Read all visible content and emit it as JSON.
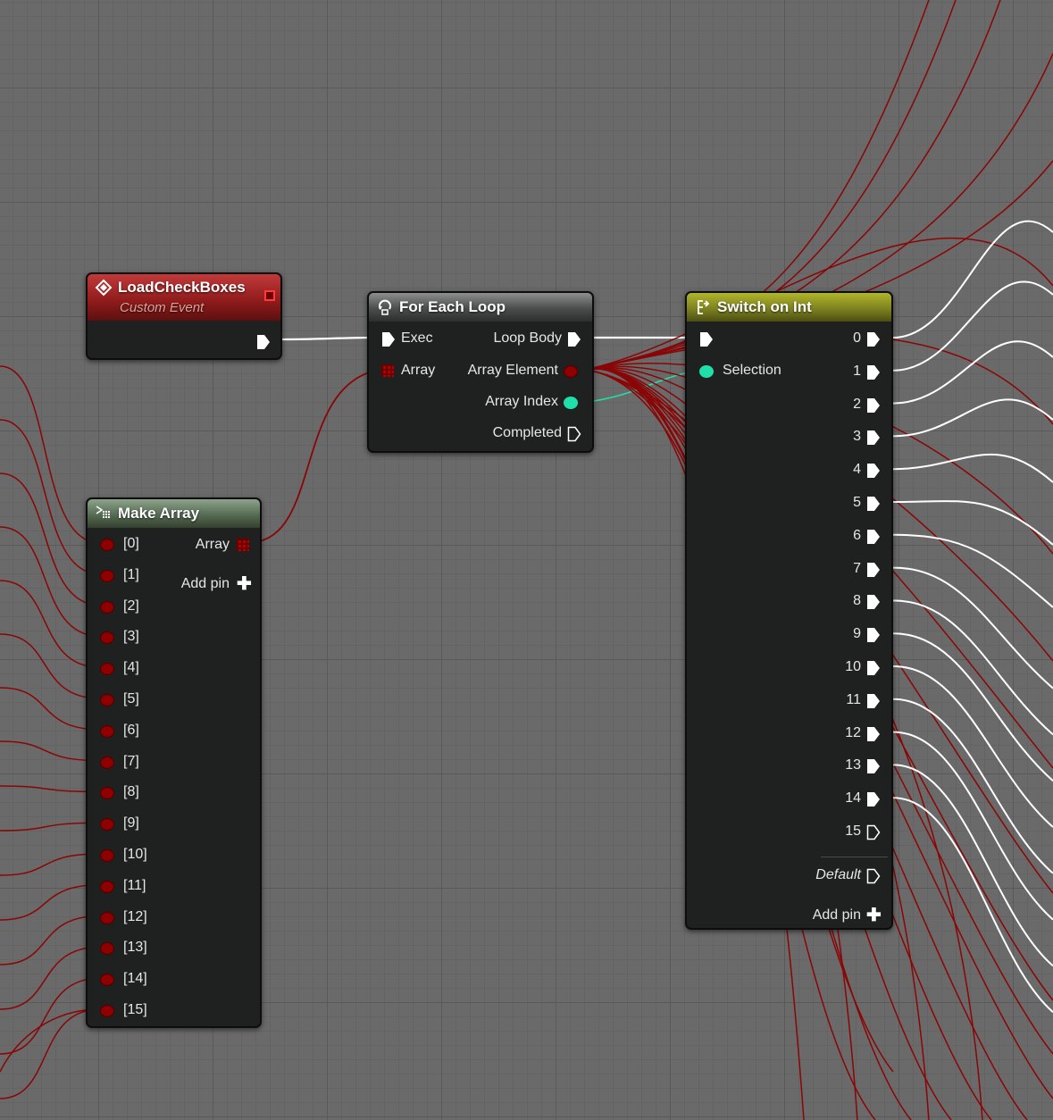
{
  "nodes": {
    "event": {
      "title": "LoadCheckBoxes",
      "subtitle": "Custom Event"
    },
    "foreach": {
      "title": "For Each Loop",
      "exec_label": "Exec",
      "array_label": "Array",
      "loop_body_label": "Loop Body",
      "array_element_label": "Array Element",
      "array_index_label": "Array Index",
      "completed_label": "Completed"
    },
    "make_array": {
      "title": "Make Array",
      "output_label": "Array",
      "add_pin_label": "Add pin",
      "inputs": [
        "[0]",
        "[1]",
        "[2]",
        "[3]",
        "[4]",
        "[5]",
        "[6]",
        "[7]",
        "[8]",
        "[9]",
        "[10]",
        "[11]",
        "[12]",
        "[13]",
        "[14]",
        "[15]"
      ]
    },
    "switch": {
      "title": "Switch on Int",
      "selection_label": "Selection",
      "outputs": [
        "0",
        "1",
        "2",
        "3",
        "4",
        "5",
        "6",
        "7",
        "8",
        "9",
        "10",
        "11",
        "12",
        "13",
        "14",
        "15"
      ],
      "default_label": "Default",
      "add_pin_label": "Add pin"
    }
  },
  "colors": {
    "exec_wire": "#ffffff",
    "object_wire": "#8a0606",
    "int_wire": "#1fe0a8",
    "event_header": "#8d1a1a",
    "switch_header": "#7e8220",
    "make_array_header": "#556b52",
    "foreach_header": "#4b4d4d"
  }
}
